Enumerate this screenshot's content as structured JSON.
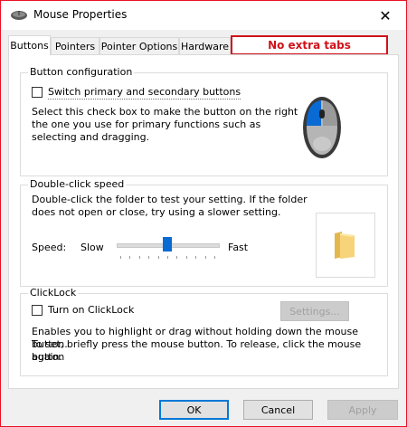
{
  "window": {
    "title": "Mouse Properties",
    "close_glyph": "✕"
  },
  "tabs": [
    {
      "label": "Buttons"
    },
    {
      "label": "Pointers"
    },
    {
      "label": "Pointer Options"
    },
    {
      "label": "Hardware"
    }
  ],
  "annotation": {
    "text": "No extra tabs",
    "color": "#d0121b"
  },
  "button_config": {
    "group_label": "Button configuration",
    "switch_label": "Switch primary and secondary buttons",
    "checked": false,
    "desc_lines": [
      "Select this check box to make the button on the right",
      "the one you use for primary functions such as",
      "selecting and dragging."
    ]
  },
  "double_click": {
    "group_label": "Double-click speed",
    "desc_lines": [
      "Double-click the folder to test your setting. If the folder",
      "does not open or close, try using a slower setting."
    ],
    "speed_label": "Speed:",
    "slow_label": "Slow",
    "fast_label": "Fast",
    "slider_level": 0.5
  },
  "clicklock": {
    "group_label": "ClickLock",
    "turn_on_label": "Turn on ClickLock",
    "checked": false,
    "settings_button": "Settings...",
    "desc_lines": [
      "Enables you to highlight or drag without holding down the mouse button.",
      "To set, briefly press the mouse button. To release, click the mouse button",
      "again."
    ]
  },
  "footer": {
    "ok": "OK",
    "cancel": "Cancel",
    "apply": "Apply"
  },
  "colors": {
    "accent": "#0078d7",
    "mouse_button": "#0a6ad4"
  }
}
